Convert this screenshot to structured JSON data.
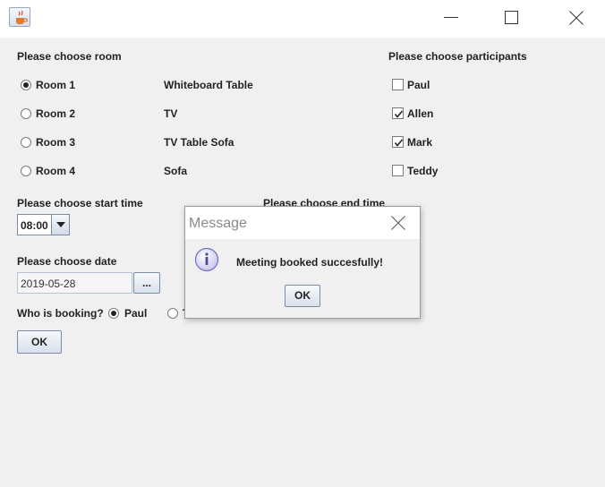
{
  "window": {
    "icon": "java-cup-icon",
    "controls": [
      "minimize-icon",
      "maximize-icon",
      "close-icon"
    ]
  },
  "rooms": {
    "heading": "Please choose room",
    "items": [
      {
        "label": "Room 1",
        "equipment": "Whiteboard Table",
        "selected": true
      },
      {
        "label": "Room 2",
        "equipment": "TV",
        "selected": false
      },
      {
        "label": "Room 3",
        "equipment": "TV Table Sofa",
        "selected": false
      },
      {
        "label": "Room 4",
        "equipment": "Sofa",
        "selected": false
      }
    ]
  },
  "participants": {
    "heading": "Please choose participants",
    "items": [
      {
        "label": "Paul",
        "checked": false
      },
      {
        "label": "Allen",
        "checked": true
      },
      {
        "label": "Mark",
        "checked": true
      },
      {
        "label": "Teddy",
        "checked": false
      }
    ]
  },
  "start_time": {
    "heading": "Please choose start time",
    "value": "08:00"
  },
  "end_time": {
    "heading": "Please choose end time"
  },
  "date": {
    "heading": "Please choose date",
    "value": "2019-05-28",
    "picker_label": "..."
  },
  "booker": {
    "label": "Who is booking?",
    "options": [
      {
        "label": "Paul",
        "selected": true
      },
      {
        "label": "T",
        "selected": false
      }
    ]
  },
  "ok_label": "OK",
  "dialog": {
    "title": "Message",
    "icon": "info-icon",
    "message": "Meeting booked succesfully!",
    "ok_label": "OK"
  }
}
